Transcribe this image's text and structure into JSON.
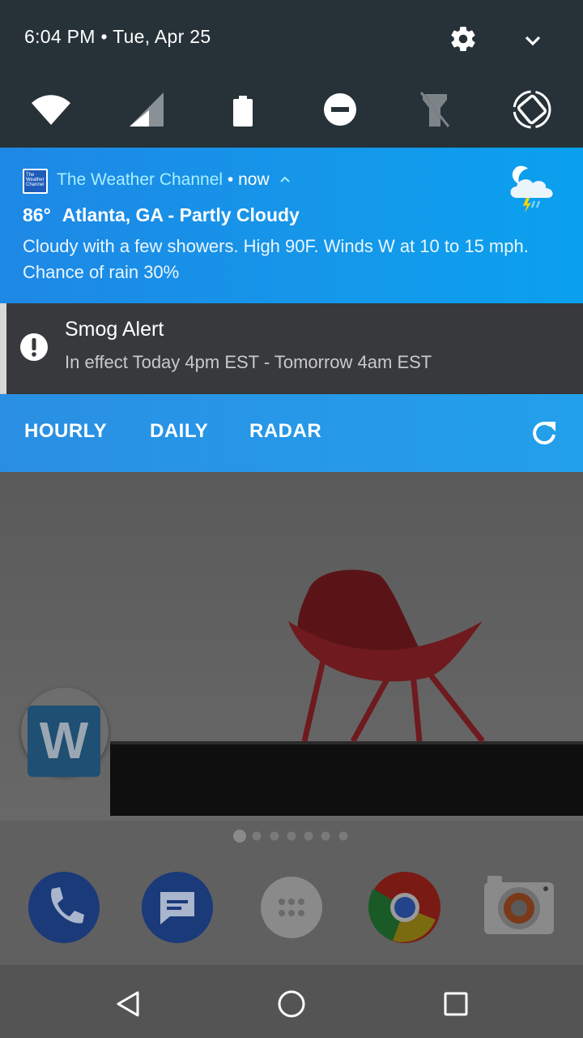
{
  "status": {
    "datetime": "6:04 PM • Tue, Apr 25"
  },
  "quick_settings": [
    "wifi-icon",
    "cell-signal-icon",
    "battery-icon",
    "do-not-disturb-icon",
    "flashlight-off-icon",
    "auto-rotate-icon"
  ],
  "weather_notification": {
    "app_name": "The Weather Channel",
    "time": " • now",
    "logo_text": "The Weather Channel",
    "temperature": "86°",
    "title": "Atlanta, GA - Partly Cloudy",
    "body": "Cloudy with a few showers. High 90F. Winds W at 10 to 15 mph. Chance of rain 30%",
    "accent_color": "#1e88e5"
  },
  "smog_alert": {
    "title": "Smog Alert",
    "body": "In effect Today 4pm EST - Tomorrow 4am EST"
  },
  "actions": {
    "hourly": "HOURLY",
    "daily": "DAILY",
    "radar": "RADAR"
  },
  "home": {
    "widget_letter": "W",
    "page_count": 7,
    "current_page": 1,
    "dock": [
      "phone-icon",
      "messages-icon",
      "app-drawer-icon",
      "chrome-icon",
      "camera-icon"
    ]
  },
  "navbar": [
    "back-icon",
    "home-icon",
    "recents-icon"
  ]
}
